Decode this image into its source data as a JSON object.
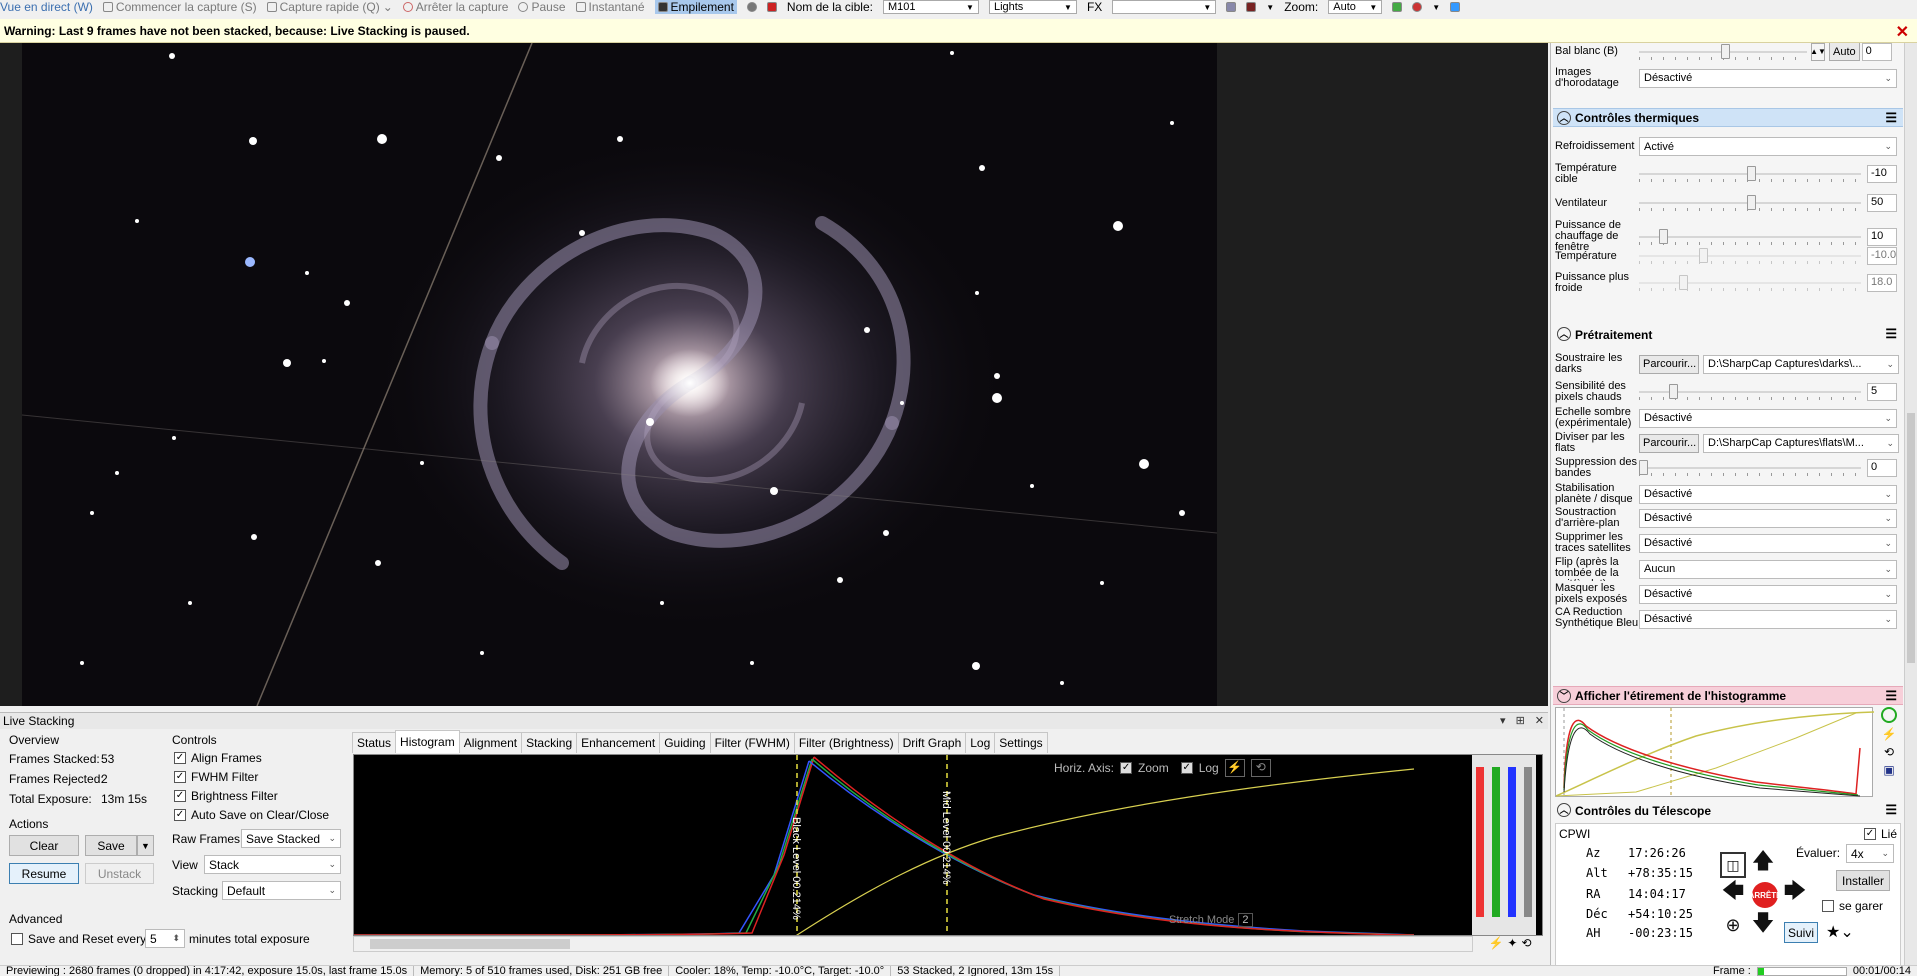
{
  "toolbar": {
    "live_view": "Vue en direct (W)",
    "start_capture": "Commencer la capture (S)",
    "quick_capture": "Capture rapide (Q)",
    "stop_capture": "Arrêter la capture",
    "pause": "Pause",
    "snapshot": "Instantané",
    "stacking": "Empilement",
    "target_label": "Nom de la cible:",
    "target_value": "M101",
    "frame_type": "Lights",
    "fx_label": "FX",
    "zoom_label": "Zoom:",
    "zoom_value": "Auto"
  },
  "warning": {
    "text": "Warning: Last 9 frames have not been stacked, because: Live Stacking is paused."
  },
  "camera": {
    "wb_label": "Bal blanc (B)",
    "wb_auto": "Auto",
    "wb_value": "0",
    "timestamp_label": "Images d'horodatage",
    "timestamp_value": "Désactivé"
  },
  "thermal": {
    "title": "Contrôles thermiques",
    "cooling_label": "Refroidissement",
    "cooling_value": "Activé",
    "target_temp_label": "Température cible",
    "target_temp_value": "-10",
    "fan_label": "Ventilateur",
    "fan_value": "50",
    "heater_label": "Puissance de chauffage de fenêtre",
    "heater_value": "10",
    "temp_label": "Température",
    "temp_value": "-10.0",
    "power_label": "Puissance plus froide",
    "power_value": "18.0"
  },
  "preprocessing": {
    "title": "Prétraitement",
    "darks_label": "Soustraire les darks",
    "browse": "Parcourir...",
    "darks_path": "D:\\SharpCap Captures\\darks\\...",
    "hotpix_label": "Sensibilité des pixels chauds",
    "hotpix_value": "5",
    "dark_scale_label": "Échelle sombre (expérimentale)",
    "dark_scale_value": "Désactivé",
    "flats_label": "Diviser par les flats",
    "flats_path": "D:\\SharpCap Captures\\flats\\M...",
    "banding_label": "Suppression des bandes",
    "banding_value": "0",
    "stab_label": "Stabilisation planète / disque",
    "stab_value": "Désactivé",
    "bg_label": "Soustraction d'arrière-plan",
    "bg_value": "Désactivé",
    "sat_label": "Supprimer les traces satellites",
    "sat_value": "Désactivé",
    "flip_label": "Flip (après la tombée de la nuit/à plat)",
    "flip_value": "Aucun",
    "mask_label": "Masquer les pixels exposés",
    "mask_value": "Désactivé",
    "ca_label": "CA Reduction Synthétique Bleu",
    "ca_value": "Désactivé"
  },
  "histo_stretch": {
    "title": "Afficher l'étirement de l'histogramme"
  },
  "telescope": {
    "title": "Contrôles du Télescope",
    "mount": "CPWI",
    "linked_label": "Lié",
    "az_label": "Az",
    "az_value": "17:26:26",
    "alt_label": "Alt",
    "alt_value": "+78:35:15",
    "ra_label": "RA",
    "ra_value": "14:04:17",
    "dec_label": "Déc",
    "dec_value": "+54:10:25",
    "ha_label": "AH",
    "ha_value": "-00:23:15",
    "evaluate_label": "Évaluer:",
    "evaluate_value": "4x",
    "stop_label": "ARRÊTE",
    "install_label": "Installer",
    "park_label": "se garer",
    "track_label": "Suivi"
  },
  "live_stacking": {
    "title": "Live Stacking",
    "overview_label": "Overview",
    "frames_stacked_label": "Frames Stacked:",
    "frames_stacked_value": "53",
    "frames_rejected_label": "Frames Rejected:",
    "frames_rejected_value": "2",
    "total_exposure_label": "Total Exposure:",
    "total_exposure_value": "13m 15s",
    "actions_label": "Actions",
    "clear": "Clear",
    "save": "Save",
    "resume": "Resume",
    "unstack": "Unstack",
    "advanced_label": "Advanced",
    "save_reset_label": "Save and Reset every",
    "save_reset_value": "5",
    "save_reset_suffix": "minutes total exposure",
    "controls_label": "Controls",
    "align_frames": "Align Frames",
    "fwhm_filter": "FWHM Filter",
    "brightness_filter": "Brightness Filter",
    "auto_save": "Auto Save on Clear/Close",
    "raw_frames_label": "Raw Frames",
    "raw_frames_value": "Save Stacked",
    "view_label": "View",
    "view_value": "Stack",
    "stacking_label": "Stacking",
    "stacking_value": "Default"
  },
  "tabs": [
    "Status",
    "Histogram",
    "Alignment",
    "Stacking",
    "Enhancement",
    "Guiding",
    "Filter (FWHM)",
    "Filter (Brightness)",
    "Drift Graph",
    "Log",
    "Settings"
  ],
  "active_tab": "Histogram",
  "histogram": {
    "horiz_axis_label": "Horiz. Axis:",
    "zoom_label": "Zoom",
    "log_label": "Log",
    "black_level": "Black Level 00.214%",
    "mid_level": "Mid Level 00.214%",
    "stretch_mode_label": "Stretch Mode",
    "stretch_mode_value": "2"
  },
  "status": {
    "previewing": "Previewing : 2680 frames (0 dropped) in 4:17:42, exposure 15.0s, last frame 15.0s",
    "memory": "Memory: 5 of 510 frames used, Disk: 251 GB free",
    "cooler": "Cooler: 18%, Temp: -10.0°C, Target: -10.0°",
    "stack": "53 Stacked, 2 Ignored, 13m 15s",
    "frame_label": "Frame :",
    "time": "00:01/00:14"
  },
  "colors": {
    "accent_blue": "#cfe3f7",
    "pink_header": "#f7cfd9",
    "warning_bg": "#ffffe1",
    "stop_red": "#e02020"
  }
}
